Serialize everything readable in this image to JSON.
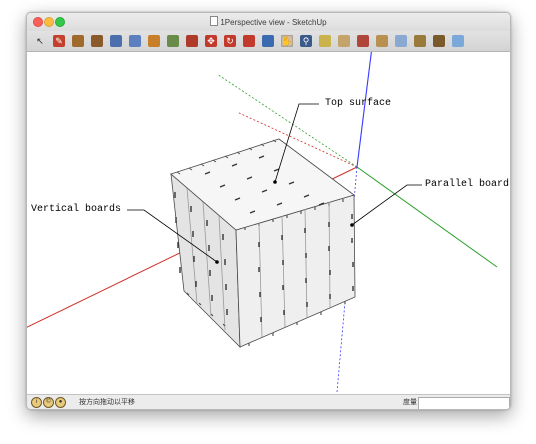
{
  "window": {
    "title": "1Perspective view - SketchUp"
  },
  "toolbar": {
    "tools": [
      {
        "name": "select-tool-icon",
        "color": "#ffffff",
        "glyph": "↖"
      },
      {
        "name": "pencil-tool-icon",
        "color": "#c2402c",
        "glyph": "✎"
      },
      {
        "name": "rectangle-tool-icon",
        "color": "#a06a2c",
        "glyph": ""
      },
      {
        "name": "circle-tool-icon",
        "color": "#8a5a2a",
        "glyph": ""
      },
      {
        "name": "arc-tool-icon",
        "color": "#4d6fae",
        "glyph": ""
      },
      {
        "name": "make-component-icon",
        "color": "#5b7fbf",
        "glyph": ""
      },
      {
        "name": "paint-bucket-icon",
        "color": "#c87f2a",
        "glyph": ""
      },
      {
        "name": "eraser-icon",
        "color": "#6a8c4a",
        "glyph": ""
      },
      {
        "name": "push-pull-icon",
        "color": "#b03a2a",
        "glyph": ""
      },
      {
        "name": "move-icon",
        "color": "#c23a2c",
        "glyph": "✥"
      },
      {
        "name": "rotate-icon",
        "color": "#c23a2c",
        "glyph": "↻"
      },
      {
        "name": "scale-icon",
        "color": "#c23a2c",
        "glyph": ""
      },
      {
        "name": "orbit-icon",
        "color": "#3a6ab0",
        "glyph": ""
      },
      {
        "name": "pan-icon",
        "color": "#d5c2a5",
        "glyph": "✋"
      },
      {
        "name": "zoom-icon",
        "color": "#3a5a8a",
        "glyph": "⚲"
      },
      {
        "name": "zoom-extents-icon",
        "color": "#c9b34a",
        "glyph": ""
      },
      {
        "name": "warehouse-icon",
        "color": "#c4a46a",
        "glyph": ""
      },
      {
        "name": "components-icon",
        "color": "#b0463a",
        "glyph": ""
      },
      {
        "name": "extension-warehouse-icon",
        "color": "#b89050",
        "glyph": ""
      },
      {
        "name": "layout-icon",
        "color": "#8aa9d0",
        "glyph": ""
      },
      {
        "name": "styles-icon",
        "color": "#9a7a3a",
        "glyph": ""
      },
      {
        "name": "scenes-icon",
        "color": "#7a5a2a",
        "glyph": ""
      },
      {
        "name": "share-model-icon",
        "color": "#7aa8d8",
        "glyph": ""
      }
    ]
  },
  "callouts": {
    "top_surface": "Top surface",
    "vertical_boards": "Vertical boards",
    "parallel_boards": "Parallel boards"
  },
  "statusbar": {
    "hint": "按方向拖动以平移",
    "measurements_label": "度量",
    "measurements_value": ""
  },
  "colors": {
    "axis_red": "#d0302a",
    "axis_green": "#2aa02a",
    "axis_blue": "#3a3aff",
    "board_fill": "#ebebeb"
  }
}
